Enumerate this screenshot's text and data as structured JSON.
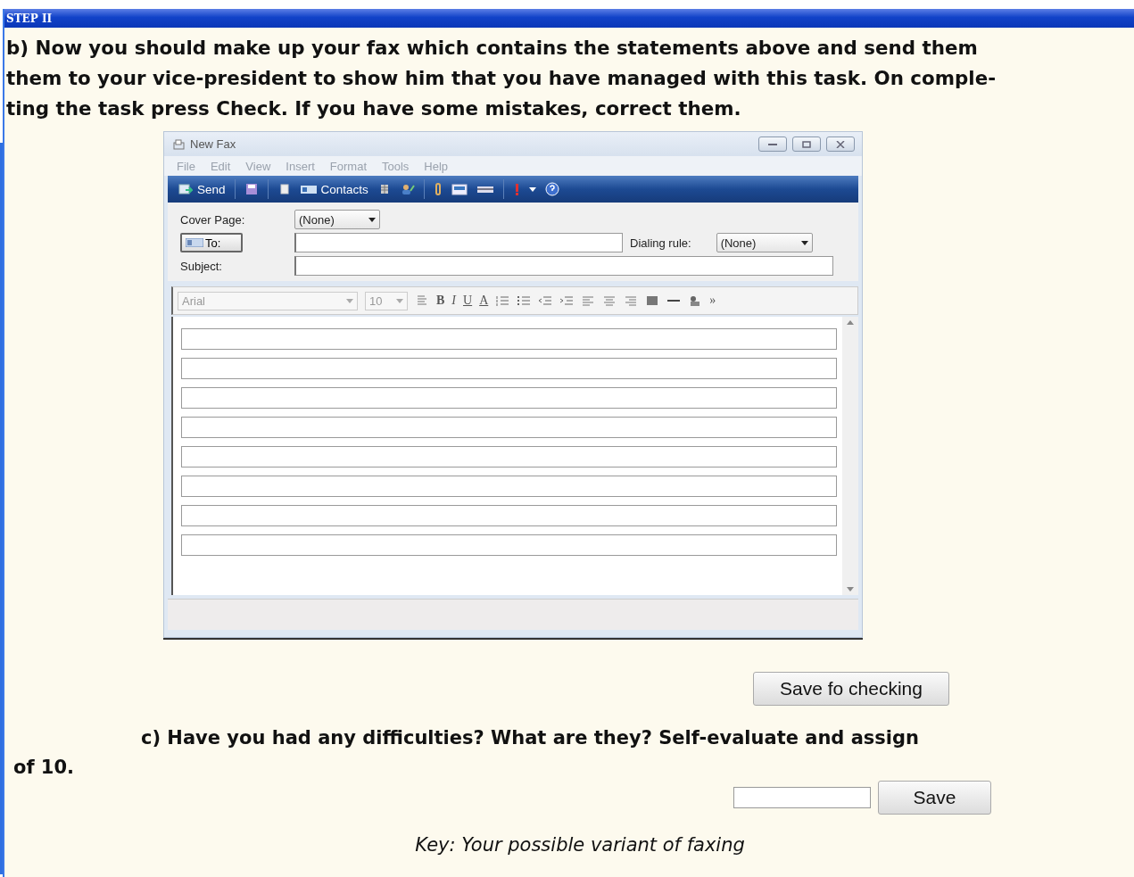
{
  "header": {
    "title": "STEP II"
  },
  "instructions": [
    "b) Now you should make up your fax which contains the statements above and send them",
    "them to your vice-president to show him that you have managed with this task. On comple-",
    "ting the task press Check. If you have some mistakes, correct them."
  ],
  "fax_window": {
    "title": "New Fax",
    "menu": [
      "File",
      "Edit",
      "View",
      "Insert",
      "Format",
      "Tools",
      "Help"
    ],
    "toolbar": {
      "send": "Send",
      "contacts": "Contacts"
    },
    "cover_page": {
      "label": "Cover Page:",
      "value": "(None)"
    },
    "to_button": "To:",
    "dialing_rule": {
      "label": "Dialing rule:",
      "value": "(None)"
    },
    "subject": {
      "label": "Subject:"
    },
    "format_bar": {
      "font": "Arial",
      "size": "10",
      "bold": "B",
      "italic": "I",
      "underline": "U",
      "font_color": "A",
      "more": "»"
    },
    "body_lines": [
      {
        "kind": "line"
      },
      {
        "kind": "line"
      },
      {
        "kind": "line"
      },
      {
        "kind": "line"
      },
      {
        "kind": "line"
      },
      {
        "kind": "line"
      },
      {
        "kind": "line"
      },
      {
        "kind": "line"
      }
    ]
  },
  "save_check_button": "Save fo checking",
  "question": "c) Have you had any difficulties? What are they? Self-evaluate and assign of 10.",
  "save_button": "Save",
  "key_note": "Key: Your possible variant of faxing"
}
